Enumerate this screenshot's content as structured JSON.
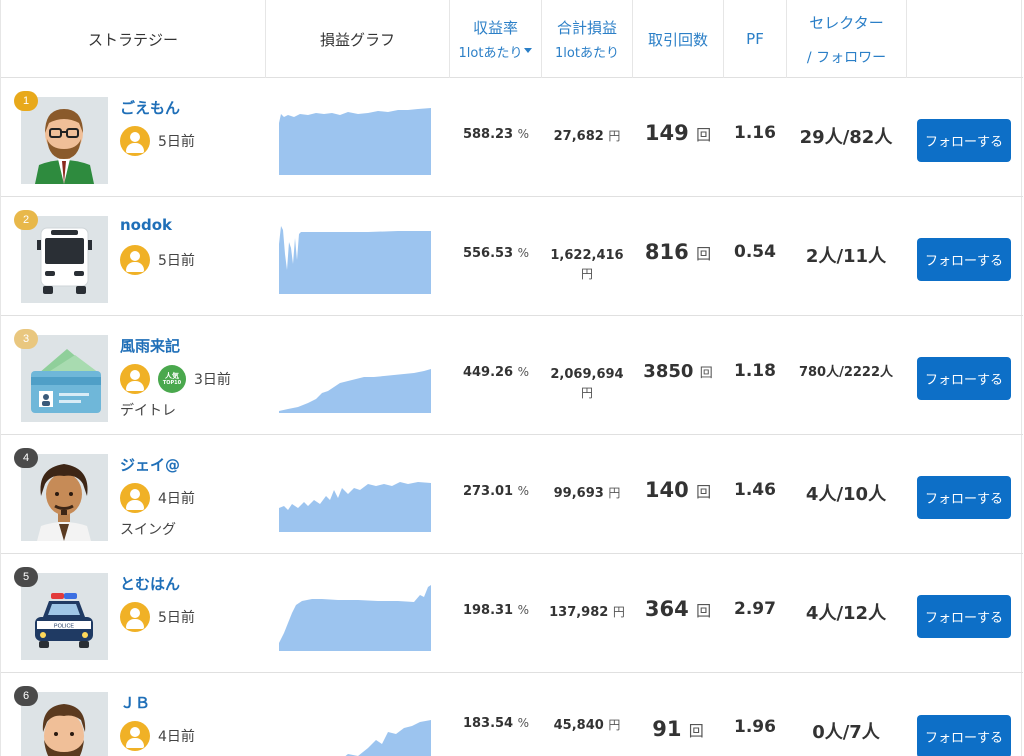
{
  "header": {
    "strategy": "ストラテジー",
    "graph": "損益グラフ",
    "rate": "収益率",
    "rate_sub": "1lotあたり",
    "profit": "合計損益",
    "profit_sub": "1lotあたり",
    "trades": "取引回数",
    "pf": "PF",
    "selector": "セレクター",
    "selector_sub": "/ フォロワー"
  },
  "colors": {
    "accent": "#0d6fc7",
    "link": "#1f6fb8",
    "graph_fill": "#9cc4ef",
    "user_icon": "#f0b126",
    "popular": "#4aa84d"
  },
  "rows": [
    {
      "rank": "1",
      "rank_color": "#e8a91b",
      "name": "ごえもん",
      "ago": "5日前",
      "style": "",
      "popular": false,
      "rate": "588.23",
      "pct": "%",
      "profit": "27,682",
      "yen": "円",
      "trades": "149",
      "kai": "回",
      "pf": "1.16",
      "selector": "29人/82人",
      "follow": "フォローする",
      "avatar": "glasses-man-icon"
    },
    {
      "rank": "2",
      "rank_color": "#e8b84a",
      "name": "nodok",
      "ago": "5日前",
      "style": "",
      "popular": false,
      "rate": "556.53",
      "pct": "%",
      "profit": "1,622,416",
      "yen": "円",
      "trades": "816",
      "kai": "回",
      "pf": "0.54",
      "selector": "2人/11人",
      "follow": "フォローする",
      "avatar": "bus-icon"
    },
    {
      "rank": "3",
      "rank_color": "#e9c77f",
      "name": "風雨来記",
      "ago": "3日前",
      "style": "デイトレ",
      "popular": true,
      "popular_line1": "人気",
      "popular_line2": "TOP10",
      "rate": "449.26",
      "pct": "%",
      "profit": "2,069,694",
      "yen": "円",
      "trades": "3850",
      "kai": "回",
      "pf": "1.18",
      "selector": "780人/2222人",
      "follow": "フォローする",
      "avatar": "wallet-icon"
    },
    {
      "rank": "4",
      "rank_color": "#4a4a4a",
      "name": "ジェイ@",
      "ago": "4日前",
      "style": "スイング",
      "popular": false,
      "rate": "273.01",
      "pct": "%",
      "profit": "99,693",
      "yen": "円",
      "trades": "140",
      "kai": "回",
      "pf": "1.46",
      "selector": "4人/10人",
      "follow": "フォローする",
      "avatar": "curly-man-icon"
    },
    {
      "rank": "5",
      "rank_color": "#4a4a4a",
      "name": "とむはん",
      "ago": "5日前",
      "style": "",
      "popular": false,
      "rate": "198.31",
      "pct": "%",
      "profit": "137,982",
      "yen": "円",
      "trades": "364",
      "kai": "回",
      "pf": "2.97",
      "selector": "4人/12人",
      "follow": "フォローする",
      "avatar": "police-car-icon",
      "police_label": "POLICE"
    },
    {
      "rank": "6",
      "rank_color": "#4a4a4a",
      "name": "ＪＢ",
      "ago": "4日前",
      "style": "",
      "popular": false,
      "rate": "183.54",
      "pct": "%",
      "profit": "45,840",
      "yen": "円",
      "trades": "91",
      "kai": "回",
      "pf": "1.96",
      "selector": "0人/7人",
      "follow": "フォローする",
      "avatar": "bearded-man-icon"
    }
  ]
}
